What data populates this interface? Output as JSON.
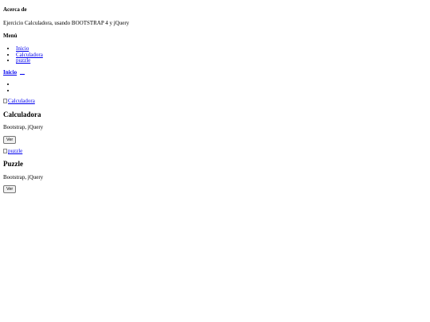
{
  "about": {
    "title": "Acerca de",
    "description": "Ejercicio Calculadora, usando BOOTSTRAP 4 y jQuery"
  },
  "menu": {
    "title": "Menú",
    "items": [
      {
        "label": "Inicio"
      },
      {
        "label": "Calculadora"
      },
      {
        "label": "puzzle"
      }
    ]
  },
  "navbar": {
    "brand": "Inicio",
    "toggler_icon": "hamburger-icon"
  },
  "cards": [
    {
      "image_alt": "Calculadora",
      "title": "Calculadora",
      "text": "Bootstrap, jQuery",
      "button_label": "Ver"
    },
    {
      "image_alt": "puzzle",
      "title": "Puzzle",
      "text": "Bootstrap, jQuery",
      "button_label": "Ver"
    }
  ],
  "colors": {
    "link": "#0000ee",
    "text": "#000000",
    "background": "#ffffff"
  }
}
